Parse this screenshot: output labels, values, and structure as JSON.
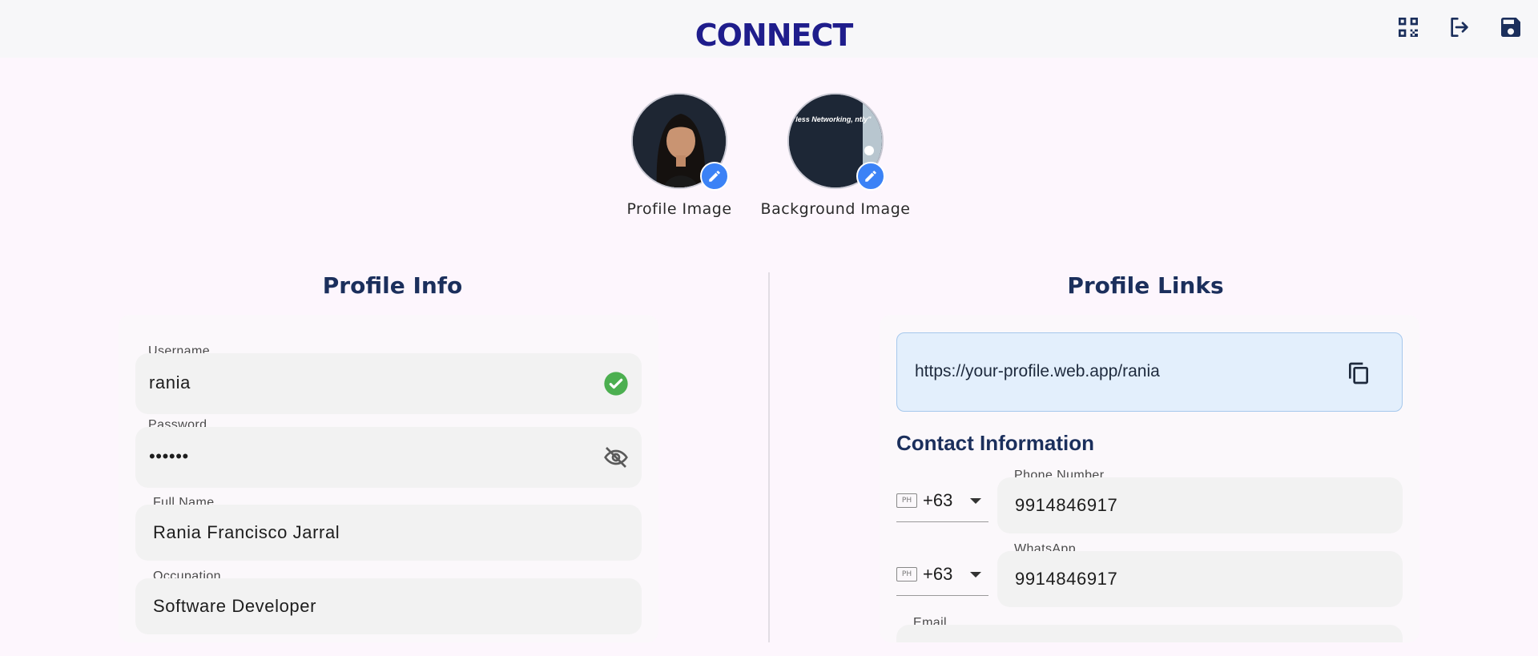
{
  "header": {
    "logo_text": "CONNECT",
    "icons": [
      "qr-code-icon",
      "logout-icon",
      "save-icon"
    ]
  },
  "images": {
    "profile_label": "Profile Image",
    "background_label": "Background Image",
    "background_overlay_text": "\"less Networking, ntly\""
  },
  "profile_info": {
    "title": "Profile Info",
    "username": {
      "label": "Username",
      "value": "rania"
    },
    "password": {
      "label": "Password",
      "value": "••••••"
    },
    "full_name": {
      "label": "Full Name",
      "value": "Rania Francisco Jarral"
    },
    "occupation": {
      "label": "Occupation",
      "value": "Software Developer"
    }
  },
  "profile_links": {
    "title": "Profile Links",
    "url": "https://your-profile.web.app/rania",
    "contact_title": "Contact Information",
    "flag_text": "PH",
    "phone": {
      "label": "Phone Number",
      "country_code": "+63",
      "value": "9914846917"
    },
    "whatsapp": {
      "label": "WhatsApp",
      "country_code": "+63",
      "value": "9914846917"
    },
    "email": {
      "label": "Email"
    }
  },
  "colors": {
    "accent": "#3b82f6",
    "title": "#1b2f5c",
    "logo": "#1f1d8c",
    "valid": "#4caf50"
  }
}
